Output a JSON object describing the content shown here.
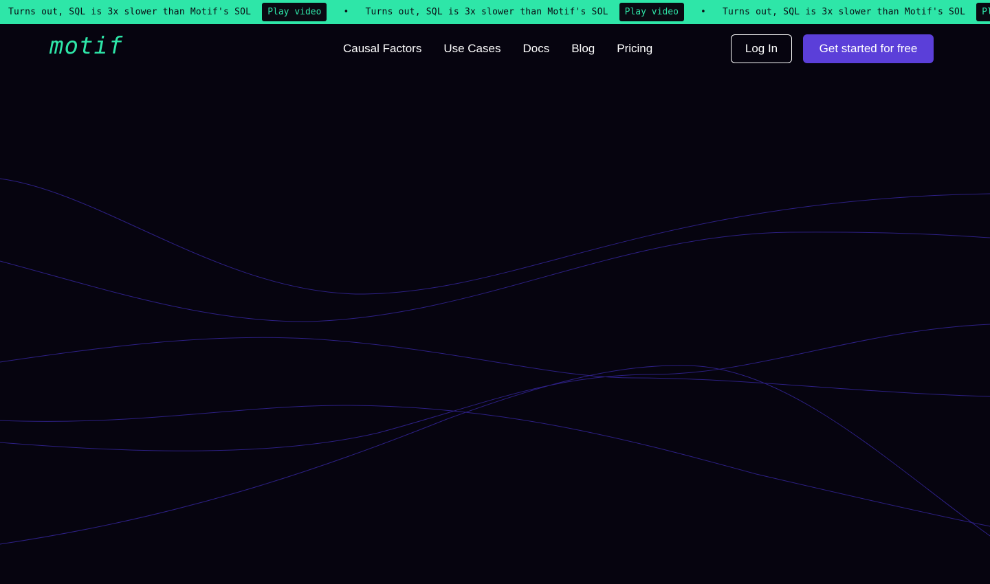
{
  "ticker": {
    "items": [
      {
        "text": "Turns out, SQL is 3x slower than Motif's SOL",
        "button": "Play video"
      },
      {
        "text": "Turns out, SQL is 3x slower than Motif's SOL",
        "button": "Play video"
      },
      {
        "text": "Turns out, SQL is 3x slower than Motif's SOL",
        "button": "Play video"
      }
    ],
    "separator": "•"
  },
  "nav": {
    "logo": "motif",
    "links": [
      "Causal Factors",
      "Use Cases",
      "Docs",
      "Blog",
      "Pricing"
    ],
    "login_label": "Log In",
    "cta_label": "Get started for free"
  },
  "colors": {
    "background": "#06040f",
    "accent": "#2ee6a8",
    "brand": "#5b3fd9",
    "wave_line": "#3a2a9a"
  }
}
